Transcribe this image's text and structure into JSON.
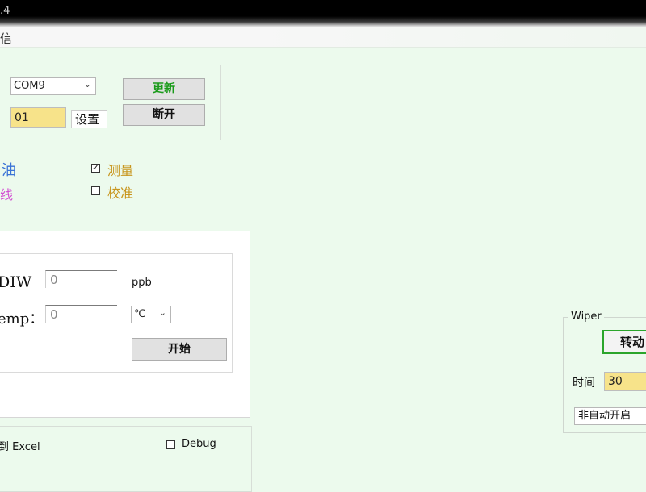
{
  "window": {
    "title_fragment": ".4"
  },
  "menu": {
    "item_fragment": "信"
  },
  "connection": {
    "port_value": "COM9",
    "address_value": "01",
    "set_label": "设置",
    "refresh_label": "更新",
    "disconnect_label": "断开"
  },
  "options": {
    "left_label_1": "油",
    "left_label_2": "线",
    "measure_label": "测量",
    "measure_checked": true,
    "calibrate_label": "校准",
    "calibrate_checked": false,
    "checked_glyph": "✓",
    "colors": {
      "left_label_1": "#3a73d6",
      "left_label_2": "#d24bd2",
      "measure": "#c8961e",
      "calibrate": "#c8961e"
    }
  },
  "measurement": {
    "row1_label": "DIW",
    "row1_value": "0",
    "row1_unit": "ppb",
    "row2_label": "emp：",
    "row2_value": "0",
    "temp_unit_value": "℃",
    "start_label": "开始"
  },
  "export": {
    "excel_label": "到 Excel",
    "debug_label": "Debug",
    "debug_checked": false
  },
  "wiper": {
    "group_label": "Wiper",
    "rotate_label": "转动",
    "time_label": "时间",
    "time_value": "30",
    "mode_value": "非自动开启"
  }
}
